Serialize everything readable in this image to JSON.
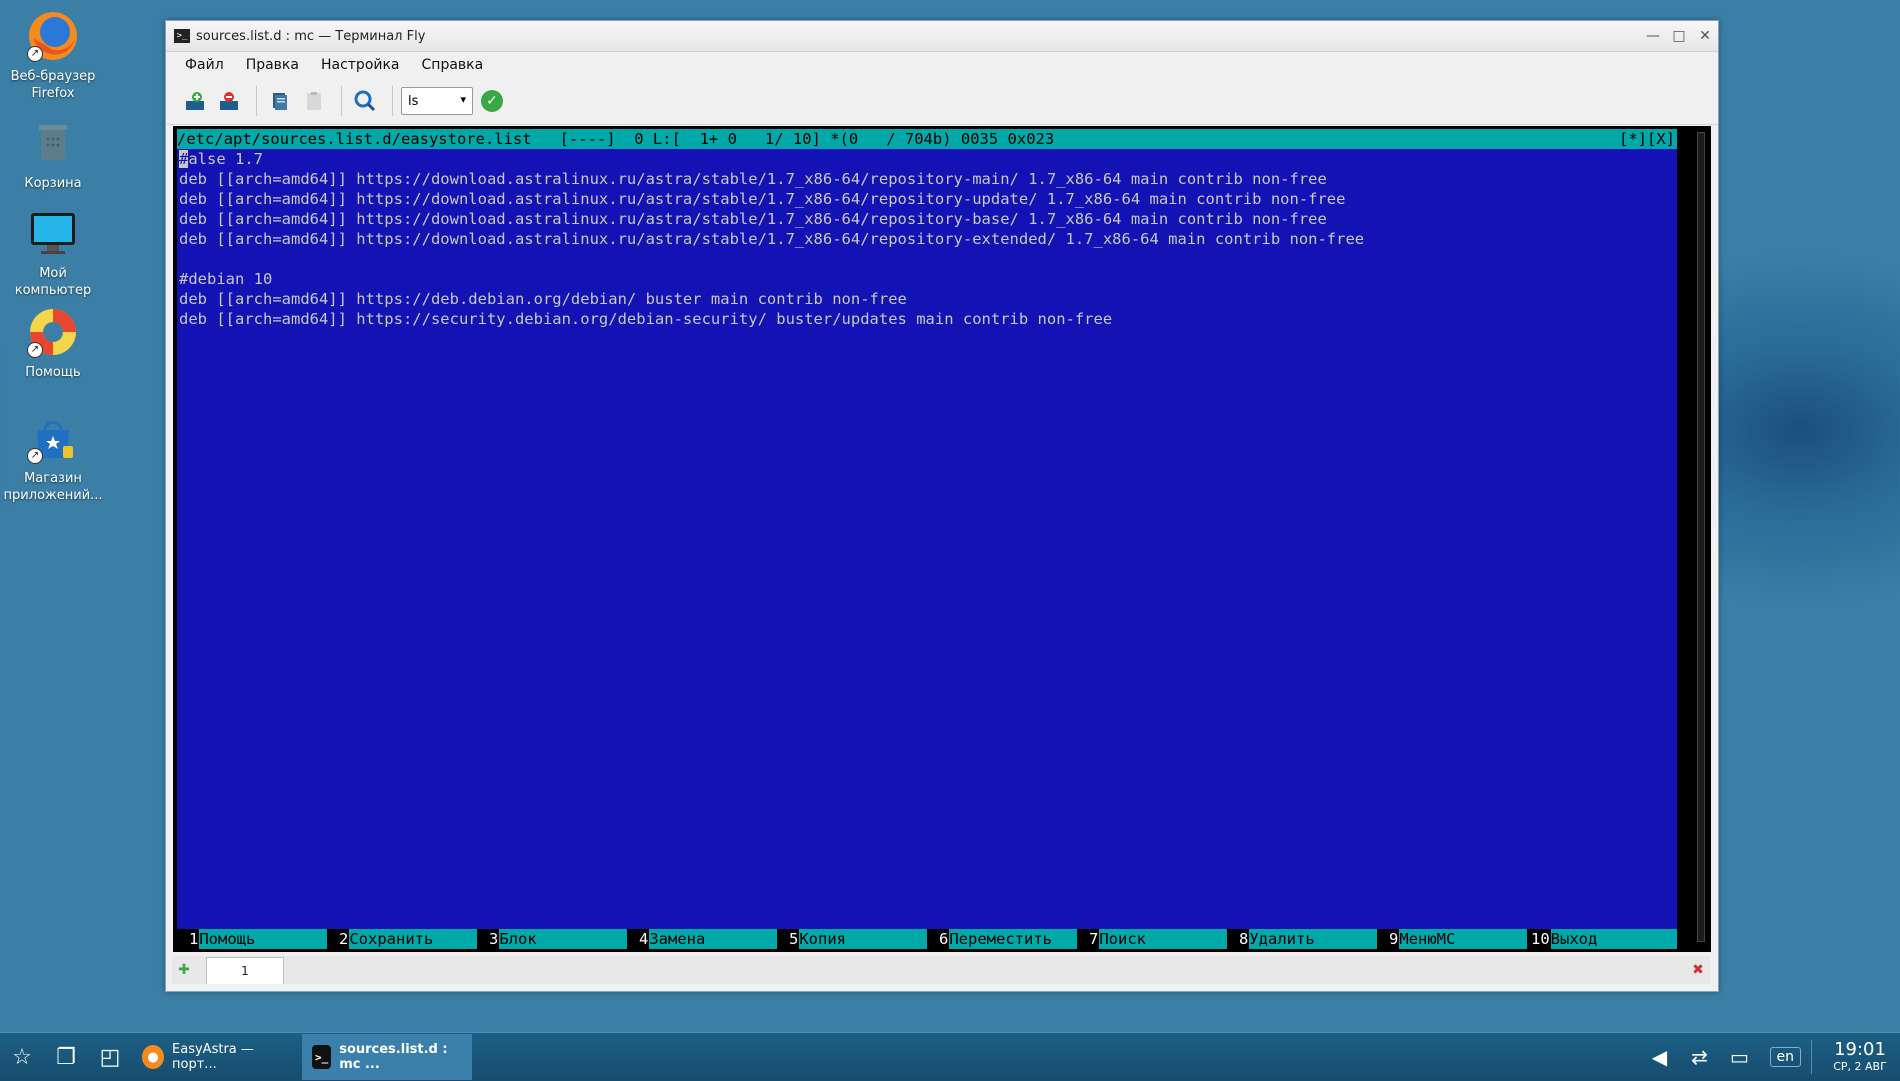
{
  "desktop": {
    "icons": [
      {
        "label": "Веб-браузер Firefox"
      },
      {
        "label": "Корзина"
      },
      {
        "label": "Мой компьютер"
      },
      {
        "label": "Помощь"
      },
      {
        "label": "Магазин приложений..."
      }
    ]
  },
  "window": {
    "title": "sources.list.d : mc — Терминал Fly",
    "menu": [
      "Файл",
      "Правка",
      "Настройка",
      "Справка"
    ],
    "select_value": "ls",
    "tab_label": "1"
  },
  "editor": {
    "status_left": "/etc/apt/sources.list.d/easystore.list   [----]  0 L:[  1+ 0   1/ 10] *(0   / 704b) 0035 0x023",
    "status_right": "[*][X]",
    "cursor_char": "#",
    "first_line_rest": "alse 1.7",
    "lines": [
      "deb [[arch=amd64]] https://download.astralinux.ru/astra/stable/1.7_x86-64/repository-main/ 1.7_x86-64 main contrib non-free",
      "deb [[arch=amd64]] https://download.astralinux.ru/astra/stable/1.7_x86-64/repository-update/ 1.7_x86-64 main contrib non-free",
      "deb [[arch=amd64]] https://download.astralinux.ru/astra/stable/1.7_x86-64/repository-base/ 1.7_x86-64 main contrib non-free",
      "deb [[arch=amd64]] https://download.astralinux.ru/astra/stable/1.7_x86-64/repository-extended/ 1.7_x86-64 main contrib non-free",
      "",
      "#debian 10",
      "deb [[arch=amd64]] https://deb.debian.org/debian/ buster main contrib non-free",
      "deb [[arch=amd64]] https://security.debian.org/debian-security/ buster/updates main contrib non-free"
    ],
    "fkeys": [
      {
        "n": "1",
        "label": "Помощь"
      },
      {
        "n": "2",
        "label": "Сохранить"
      },
      {
        "n": "3",
        "label": "Блок"
      },
      {
        "n": "4",
        "label": "Замена"
      },
      {
        "n": "5",
        "label": "Копия"
      },
      {
        "n": "6",
        "label": "Переместить"
      },
      {
        "n": "7",
        "label": "Поиск"
      },
      {
        "n": "8",
        "label": "Удалить"
      },
      {
        "n": "9",
        "label": "МенюMC"
      },
      {
        "n": "10",
        "label": "Выход"
      }
    ]
  },
  "taskbar": {
    "tasks": [
      {
        "label": "EasyAstra — порт..."
      },
      {
        "label": "sources.list.d : mc ..."
      }
    ],
    "lang": "en",
    "time": "19:01",
    "date": "СР, 2 АВГ"
  }
}
